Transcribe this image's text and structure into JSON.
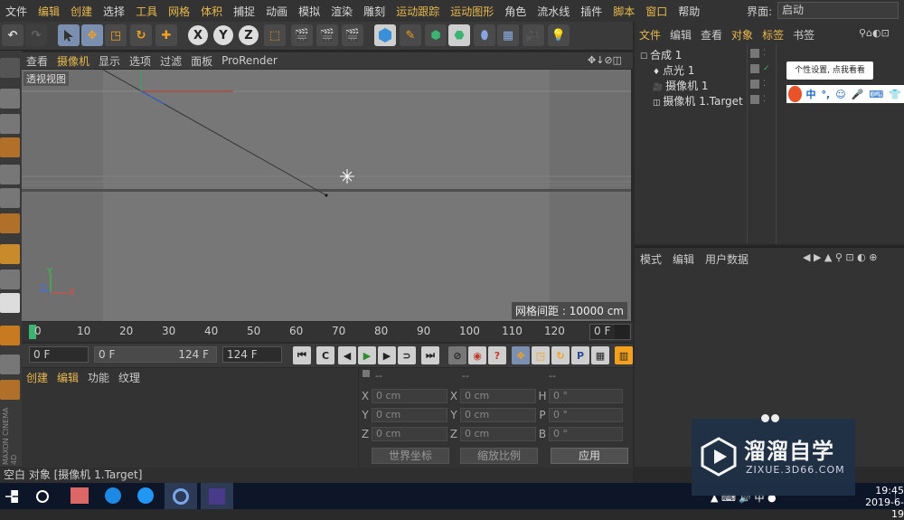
{
  "menubar": {
    "items": [
      {
        "label": "文件",
        "hl": false
      },
      {
        "label": "编辑",
        "hl": true
      },
      {
        "label": "创建",
        "hl": true
      },
      {
        "label": "选择",
        "hl": false
      },
      {
        "label": "工具",
        "hl": true
      },
      {
        "label": "网格",
        "hl": true
      },
      {
        "label": "体积",
        "hl": true
      },
      {
        "label": "捕捉",
        "hl": false
      },
      {
        "label": "动画",
        "hl": false
      },
      {
        "label": "模拟",
        "hl": false
      },
      {
        "label": "渲染",
        "hl": false
      },
      {
        "label": "雕刻",
        "hl": false
      },
      {
        "label": "运动跟踪",
        "hl": true
      },
      {
        "label": "运动图形",
        "hl": true
      },
      {
        "label": "角色",
        "hl": false
      },
      {
        "label": "流水线",
        "hl": false
      },
      {
        "label": "插件",
        "hl": false
      },
      {
        "label": "脚本",
        "hl": true
      },
      {
        "label": "窗口",
        "hl": true
      },
      {
        "label": "帮助",
        "hl": false
      }
    ],
    "interface_label": "界面:",
    "interface_value": "启动"
  },
  "toolbar": {
    "axis_x": "X",
    "axis_y": "Y",
    "axis_z": "Z"
  },
  "viewport": {
    "menu": [
      {
        "label": "查看",
        "hl": false
      },
      {
        "label": "摄像机",
        "hl": true
      },
      {
        "label": "显示",
        "hl": false
      },
      {
        "label": "选项",
        "hl": false
      },
      {
        "label": "过滤",
        "hl": false
      },
      {
        "label": "面板",
        "hl": false
      },
      {
        "label": "ProRender",
        "hl": false
      }
    ],
    "title": "透视视图",
    "grid_spacing": "网格间距 : 10000 cm",
    "axis_x": "X",
    "axis_y": "Y",
    "axis_z": "Z"
  },
  "timeline": {
    "ticks": [
      "0",
      "10",
      "20",
      "30",
      "40",
      "50",
      "60",
      "70",
      "80",
      "90",
      "100",
      "110",
      "120"
    ],
    "current_frame": "0 F"
  },
  "transport": {
    "start": "0 F",
    "range_start": "0 F",
    "range_end": "124 F",
    "end": "124 F"
  },
  "material_manager": {
    "menu": [
      {
        "label": "创建",
        "hl": true
      },
      {
        "label": "编辑",
        "hl": true
      },
      {
        "label": "功能",
        "hl": false
      },
      {
        "label": "纹理",
        "hl": false
      }
    ]
  },
  "coordinates": {
    "headers": [
      "--",
      "--",
      "--"
    ],
    "rows": [
      {
        "l1": "X",
        "v1": "0 cm",
        "l2": "X",
        "v2": "0 cm",
        "l3": "H",
        "v3": "0 °"
      },
      {
        "l1": "Y",
        "v1": "0 cm",
        "l2": "Y",
        "v2": "0 cm",
        "l3": "P",
        "v3": "0 °"
      },
      {
        "l1": "Z",
        "v1": "0 cm",
        "l2": "Z",
        "v2": "0 cm",
        "l3": "B",
        "v3": "0 °"
      }
    ],
    "world_coords": "世界坐标",
    "scale": "缩放比例",
    "apply": "应用"
  },
  "object_manager": {
    "menu": [
      {
        "label": "文件",
        "hl": true
      },
      {
        "label": "编辑",
        "hl": false
      },
      {
        "label": "查看",
        "hl": false
      },
      {
        "label": "对象",
        "hl": true
      },
      {
        "label": "标签",
        "hl": true
      },
      {
        "label": "书签",
        "hl": false
      }
    ],
    "objects": [
      {
        "name": "合成 1",
        "indent": 0
      },
      {
        "name": "点光 1",
        "indent": 1
      },
      {
        "name": "摄像机 1",
        "indent": 1
      },
      {
        "name": "摄像机 1.Target",
        "indent": 1
      }
    ],
    "tooltip": "个性设置, 点我看看",
    "ime_label": "中"
  },
  "attribute_manager": {
    "menu": [
      "模式",
      "编辑",
      "用户数据"
    ]
  },
  "statusbar": {
    "text": "空白 对象 [摄像机 1.Target]"
  },
  "watermark": {
    "title": "溜溜自学",
    "sub": "ZIXUE.3D66.COM"
  },
  "taskbar": {
    "time": "19:45",
    "date": "2019-6-19"
  },
  "colors": {
    "highlight": "#e9b94d",
    "panel": "#333333",
    "viewport_bg": "#6f6f6f",
    "taskbar": "#0d1628"
  }
}
